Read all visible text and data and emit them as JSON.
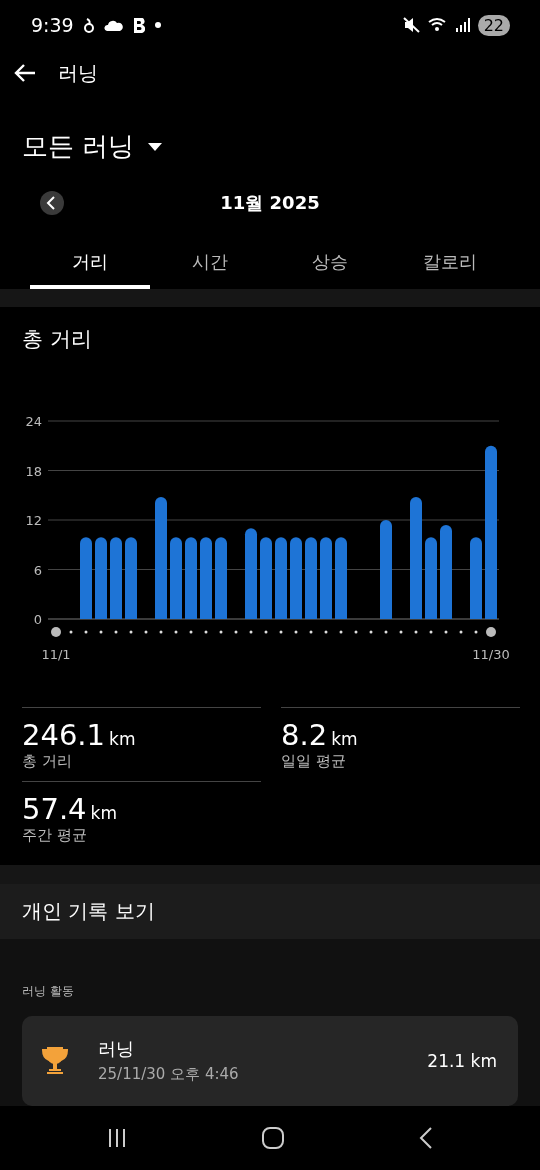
{
  "status_bar": {
    "time": "9:39",
    "battery": "22"
  },
  "header": {
    "title": "러닝"
  },
  "filter": {
    "label": "모든 러닝"
  },
  "period": {
    "label": "11월 2025"
  },
  "tabs": [
    {
      "label": "거리",
      "selected": true
    },
    {
      "label": "시간",
      "selected": false
    },
    {
      "label": "상승",
      "selected": false
    },
    {
      "label": "칼로리",
      "selected": false
    }
  ],
  "section": {
    "title": "총 거리",
    "chart_data": {
      "type": "bar",
      "categories": [
        "11/1",
        null,
        null,
        null,
        null,
        null,
        null,
        null,
        null,
        null,
        null,
        null,
        null,
        null,
        null,
        null,
        null,
        null,
        null,
        null,
        null,
        null,
        null,
        null,
        null,
        null,
        null,
        null,
        null,
        "11/30"
      ],
      "series": [
        {
          "color": "#1e74d6",
          "values": [
            null,
            null,
            9.9,
            9.9,
            9.9,
            9.9,
            null,
            14.8,
            9.9,
            9.9,
            9.9,
            9.9,
            null,
            11,
            9.9,
            9.9,
            9.9,
            9.9,
            9.9,
            9.9,
            null,
            null,
            12,
            null,
            14.8,
            9.9,
            11.4,
            null,
            9.9,
            21
          ]
        }
      ],
      "ylim": [
        0,
        24
      ],
      "yticks": [
        0,
        6,
        12,
        18,
        24
      ],
      "grid": true
    }
  },
  "stats": [
    {
      "value": "246.1",
      "unit": "km",
      "label": "총 거리"
    },
    {
      "value": "8.2",
      "unit": "km",
      "label": "일일 평균"
    },
    {
      "value": "57.4",
      "unit": "km",
      "label": "주간 평균"
    }
  ],
  "personal_records": {
    "label": "개인 기록 보기"
  },
  "activities": {
    "heading": "러닝 활동",
    "items": [
      {
        "title": "러닝",
        "date": "25/11/30 오후 4:46",
        "distance": "21.1 km"
      }
    ]
  }
}
